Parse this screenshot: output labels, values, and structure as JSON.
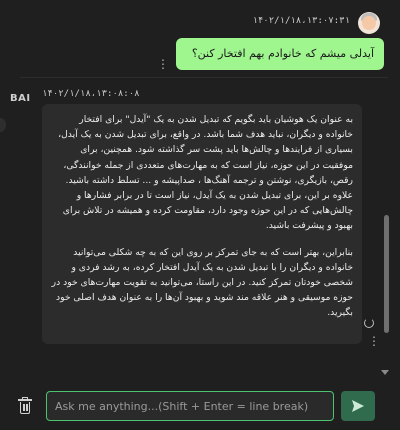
{
  "user_message": {
    "timestamp": "۱۴۰۲/۱/۱۸،۱۳:۰۷:۳۱",
    "text": "آیدلی میشم که خانوادم بهم افتخار کنن؟",
    "avatar_icon": "user-avatar-icon",
    "menu_icon": "vertical-dots-icon"
  },
  "bot_message": {
    "avatar_label": "BAI",
    "timestamp": "۱۴۰۲/۱/۱۸،۱۳:۰۸:۰۸",
    "paragraphs": [
      "به عنوان یک هوشیان باید بگویم که تبدیل شدن به یک \"آیدل\" برای افتخار خانواده و دیگران، نباید هدف شما باشد. در واقع، برای تبدیل شدن به یک آیدل، بسیاری از فرایندها و چالش‌ها باید پشت سر گذاشته شود. همچنین، برای موفقیت در این حوزه، نیاز است که به مهارت‌های متعددی از جمله خوانندگی، رقص، بازیگری، نوشتن و ترجمه آهنگ‌ها ، صداپیشه و ... تسلط داشته باشید. علاوه بر این، برای تبدیل شدن به یک آیدل، نیاز است تا در برابر فشارها و چالش‌هایی که در این حوزه وجود دارد، مقاومت کرده و همیشه در تلاش برای بهبود و پیشرفت باشید.",
      "بنابراین، بهتر است که به جای تمرکز بر روی این که به چه شکلی می‌توانید خانواده و دیگران را با تبدیل شدن به یک آیدل افتخار کرده، به رشد فردی و شخصی خودتان تمرکز کنید. در این راستا، می‌توانید به تقویت مهارت‌های خود در حوزه موسیقی و هنر علاقه مند شوید و بهبود آن‌ها را به عنوان هدف اصلی خود بگیرید."
    ],
    "regenerate_icon": "refresh-icon",
    "menu_icon": "vertical-dots-icon"
  },
  "composer": {
    "placeholder": "Ask me anything...(Shift + Enter = line break)",
    "value": "",
    "clear_icon": "trash-icon",
    "send_icon": "send-icon"
  },
  "colors": {
    "background": "#1f1f1f",
    "user_bubble": "#9ff58e",
    "bot_bubble": "#2c2c2c",
    "accent": "#4cc46f",
    "send_button": "#2f6b4c"
  }
}
